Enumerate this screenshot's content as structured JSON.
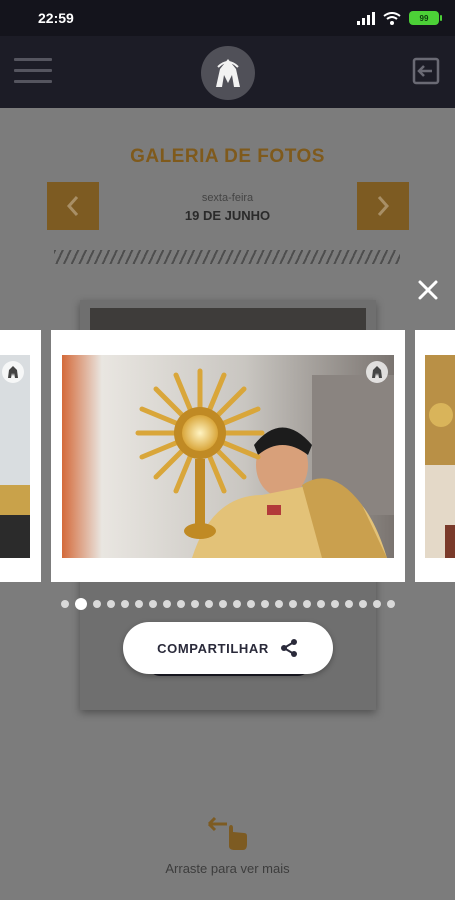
{
  "status_bar": {
    "time": "22:59",
    "battery": "99"
  },
  "header": {
    "logo": "order-emblem",
    "menu_icon": "hamburger-icon",
    "logout_icon": "logout-icon"
  },
  "page": {
    "title": "GALERIA DE FOTOS",
    "weekday": "sexta-feira",
    "date": "19 DE JUNHO",
    "prev_icon": "chevron-left-icon",
    "next_icon": "chevron-right-icon"
  },
  "lightbox": {
    "close_icon": "close-icon",
    "current_slide_index": 1,
    "slide_count": 24,
    "share_label": "COMPARTILHAR",
    "share_icon": "share-icon"
  },
  "swipe_hint": {
    "label": "Arraste para ver mais",
    "icon": "swipe-hand-icon"
  },
  "colors": {
    "accent": "#7d5b22",
    "header_bg": "#1c1c26",
    "overlay_bg": "#7c7c7c"
  }
}
